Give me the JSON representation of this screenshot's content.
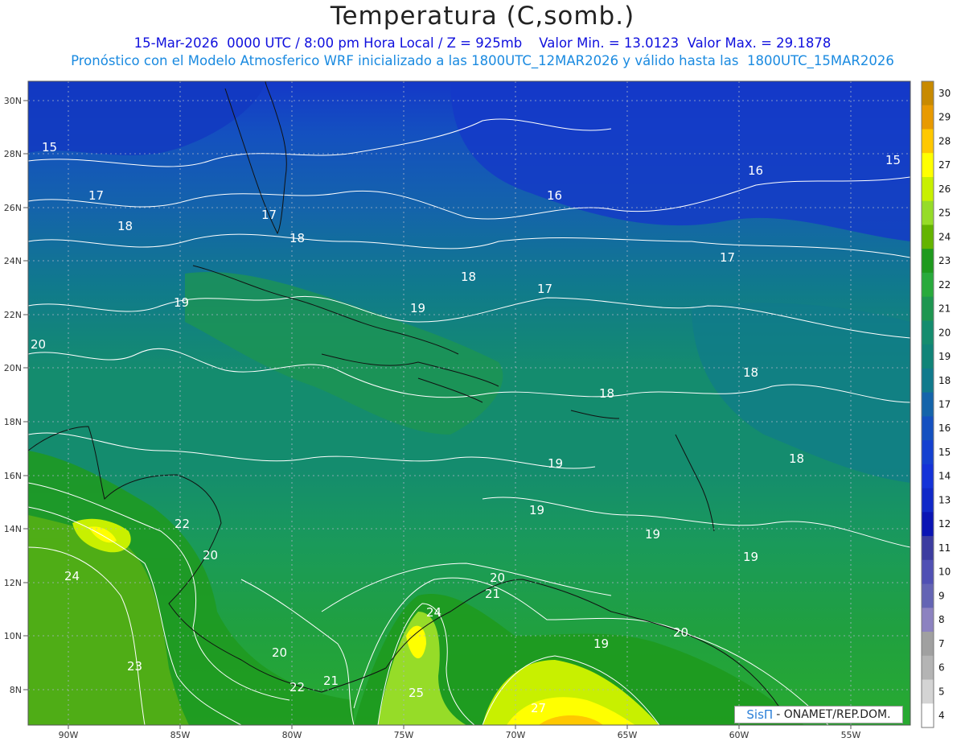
{
  "header": {
    "title": "Temperatura (C,somb.)",
    "subtitle_1": "15-Mar-2026  0000 UTC / 8:00 pm Hora Local / Z = 925mb    Valor Min. = 13.0123  Valor Max. = 29.1878",
    "subtitle_2": "Pronóstico con el Modelo Atmosferico WRF inicializado a las 1800UTC_12MAR2026 y válido hasta las  1800UTC_15MAR2026"
  },
  "map": {
    "lat_ticks": [
      "30N",
      "28N",
      "26N",
      "24N",
      "22N",
      "20N",
      "18N",
      "16N",
      "14N",
      "12N",
      "10N",
      "8N"
    ],
    "lon_ticks": [
      "90W",
      "85W",
      "80W",
      "75W",
      "70W",
      "65W",
      "60W",
      "55W"
    ],
    "contour_labels": [
      "15",
      "15",
      "16",
      "16",
      "17",
      "17",
      "17",
      "17",
      "18",
      "18",
      "18",
      "18",
      "18",
      "18",
      "19",
      "19",
      "19",
      "19",
      "19",
      "19",
      "19",
      "20",
      "20",
      "20",
      "20",
      "20",
      "21",
      "21",
      "22",
      "22",
      "23",
      "24",
      "24",
      "25",
      "27"
    ]
  },
  "colorbar": {
    "levels": [
      "30",
      "29",
      "28",
      "27",
      "26",
      "25",
      "24",
      "23",
      "22",
      "21",
      "20",
      "19",
      "18",
      "17",
      "16",
      "15",
      "14",
      "13",
      "12",
      "11",
      "10",
      "9",
      "8",
      "7",
      "6",
      "5",
      "4"
    ],
    "colors": [
      "#c88a00",
      "#e89a00",
      "#ffc800",
      "#ffff00",
      "#c8f000",
      "#96dc28",
      "#64b400",
      "#1e9a1e",
      "#28aa3c",
      "#1e9650",
      "#148c6e",
      "#108478",
      "#107a8c",
      "#1464aa",
      "#1450c0",
      "#1440d0",
      "#1432d8",
      "#1028c8",
      "#0a14b4",
      "#3c3ca0",
      "#5050b4",
      "#6464b4",
      "#8c82c0",
      "#a0a0a0",
      "#b4b4b4",
      "#d4d4d4",
      "#ffffff"
    ]
  },
  "credit": {
    "logo": "SisΠ",
    "text": "- ONAMET/REP.DOM."
  }
}
